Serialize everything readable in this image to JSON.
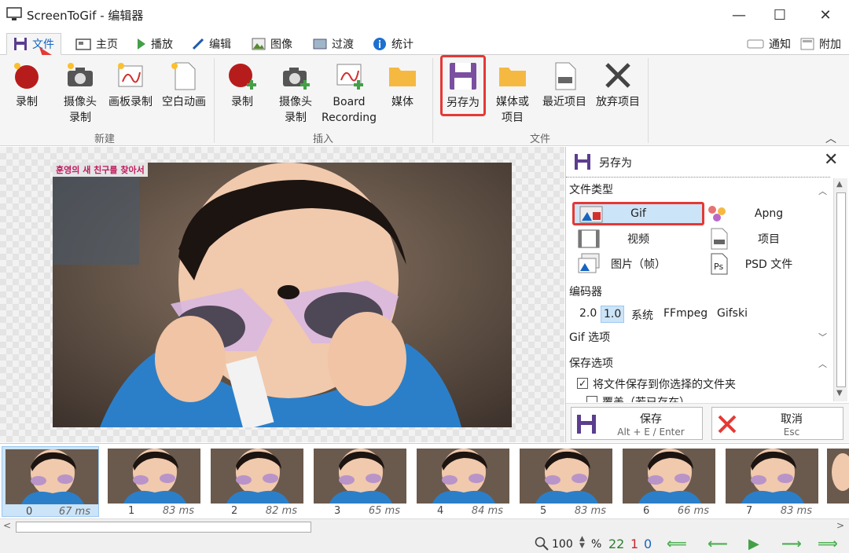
{
  "window": {
    "title": "ScreenToGif - 编辑器",
    "minimize": "—",
    "maximize": "☐",
    "close": "✕"
  },
  "tabs": [
    {
      "label": "文件"
    },
    {
      "label": "主页"
    },
    {
      "label": "播放"
    },
    {
      "label": "编辑"
    },
    {
      "label": "图像"
    },
    {
      "label": "过渡"
    },
    {
      "label": "统计"
    }
  ],
  "tab_right": {
    "notify": "通知",
    "extra": "附加"
  },
  "ribbon": {
    "new_group": "新建",
    "insert_group": "插入",
    "file_group": "文件",
    "new": {
      "record": "录制",
      "webcam_1": "摄像头",
      "webcam_2": "录制",
      "board": "画板录制",
      "blank": "空白动画"
    },
    "insert": {
      "record": "录制",
      "webcam_1": "摄像头",
      "webcam_2": "录制",
      "board_1": "Board",
      "board_2": "Recording",
      "media": "媒体"
    },
    "file": {
      "save_as": "另存为",
      "media_1": "媒体或",
      "media_2": "项目",
      "recent": "最近项目",
      "discard": "放弃项目"
    }
  },
  "preview_caption": "훈영의 새 친구를 찾아서",
  "panel": {
    "title": "另存为",
    "file_type_label": "文件类型",
    "types": {
      "gif": "Gif",
      "apng": "Apng",
      "video": "视频",
      "project": "项目",
      "image": "图片（帧）",
      "psd": "PSD 文件"
    },
    "encoder_label": "编码器",
    "encoders": [
      "2.0",
      "1.0",
      "系统",
      "FFmpeg",
      "Gifski"
    ],
    "gif_options": "Gif 选项",
    "save_options": "保存选项",
    "save_to_folder": "将文件保存到你选择的文件夹",
    "overwrite": "覆盖（若已存在）",
    "save_button": "保存",
    "save_shortcut": "Alt + E / Enter",
    "cancel_button": "取消",
    "cancel_shortcut": "Esc"
  },
  "frames": [
    {
      "index": "0",
      "ms": "67 ms"
    },
    {
      "index": "1",
      "ms": "83 ms"
    },
    {
      "index": "2",
      "ms": "82 ms"
    },
    {
      "index": "3",
      "ms": "65 ms"
    },
    {
      "index": "4",
      "ms": "84 ms"
    },
    {
      "index": "5",
      "ms": "83 ms"
    },
    {
      "index": "6",
      "ms": "66 ms"
    },
    {
      "index": "7",
      "ms": "83 ms"
    }
  ],
  "status": {
    "zoom": "100",
    "percent": "%",
    "count_total": "22",
    "count_selected": "1",
    "count_current": "0"
  },
  "colors": {
    "accent": "#1565c0",
    "highlight_red": "#e53935",
    "selection": "#cce4f7",
    "save_purple": "#7b4fa0"
  }
}
